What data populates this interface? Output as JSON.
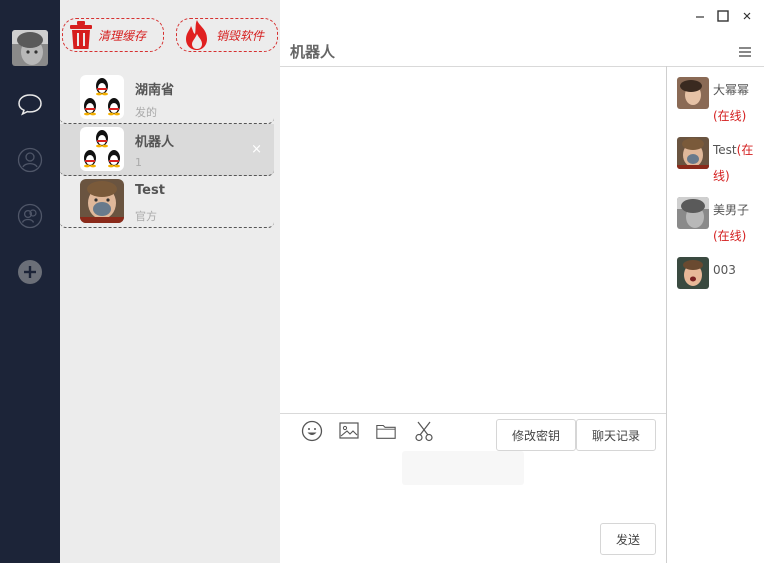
{
  "window": {
    "minimize_icon": "minimize-icon",
    "maximize_icon": "maximize-icon",
    "close_icon": "close-icon"
  },
  "nav": {
    "items": [
      "chat-bubble-icon",
      "user-icon",
      "group-icon",
      "add-icon"
    ]
  },
  "actions": {
    "clear_cache": "清理缓存",
    "destroy_software": "销毁软件"
  },
  "conversations": [
    {
      "name": "湖南省",
      "subtitle": "发的"
    },
    {
      "name": "机器人",
      "subtitle": "1",
      "close": "×"
    },
    {
      "name": "Test",
      "subtitle": "官方"
    }
  ],
  "chat": {
    "title": "机器人",
    "toolbar": [
      "emoji-icon",
      "image-icon",
      "folder-icon",
      "scissors-icon"
    ],
    "modify_key_label": "修改密钥",
    "history_label": "聊天记录",
    "send_label": "发送"
  },
  "members": [
    {
      "name": "大幂幂",
      "status": "(在线)"
    },
    {
      "name": "Test",
      "status": "(在线)"
    },
    {
      "name": "美男子",
      "status": "(在线)"
    },
    {
      "name": "003",
      "status": ""
    }
  ],
  "colors": {
    "nav_bg": "#1c2438",
    "accent_red": "#d61e1e",
    "online": "#d42020"
  }
}
